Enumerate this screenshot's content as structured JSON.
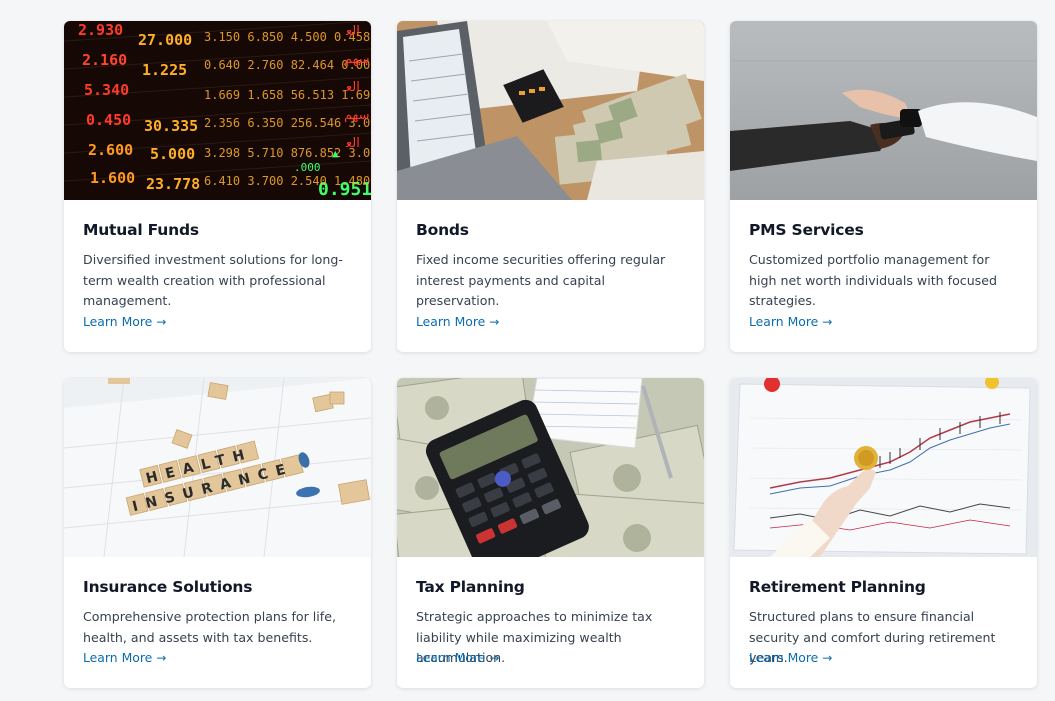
{
  "cards": [
    {
      "title": "Mutual Funds",
      "description": "Diversified investment solutions for long-term wealth creation with professional management.",
      "link": "Learn More",
      "image_alt": "stock ticker board"
    },
    {
      "title": "Bonds",
      "description": "Fixed income securities offering regular interest payments and capital preservation.",
      "link": "Learn More",
      "image_alt": "laptop, calculator and cash on desk"
    },
    {
      "title": "PMS Services",
      "description": "Customized portfolio management for high net worth individuals with focused strategies.",
      "link": "Learn More",
      "image_alt": "hands exchanging a card"
    },
    {
      "title": "Insurance Solutions",
      "description": "Comprehensive protection plans for life, health, and assets with tax benefits.",
      "link": "Learn More",
      "image_alt": "health insurance scrabble tiles"
    },
    {
      "title": "Tax Planning",
      "description": "Strategic approaches to minimize tax liability while maximizing wealth accumulation.",
      "link": "Learn More",
      "image_alt": "calculator on dollar bills"
    },
    {
      "title": "Retirement Planning",
      "description": "Structured plans to ensure financial security and comfort during retirement years.",
      "link": "Learn More",
      "image_alt": "hand holding coin over chart"
    }
  ],
  "image_text": {
    "ticker_numbers": [
      "2.930",
      "27.000",
      "2.160",
      "1.225",
      "5.340",
      "0.450",
      "30.335",
      "2.600",
      "5.000",
      "1.600",
      "23.778",
      "0.951"
    ],
    "health_tiles": "HEALTH",
    "insurance_tiles": "INSURANCE"
  },
  "link_arrow": "→",
  "colors": {
    "background": "#f5f6f8",
    "card": "#ffffff",
    "title": "#111827",
    "text": "#374151",
    "link": "#0c6cb0"
  }
}
